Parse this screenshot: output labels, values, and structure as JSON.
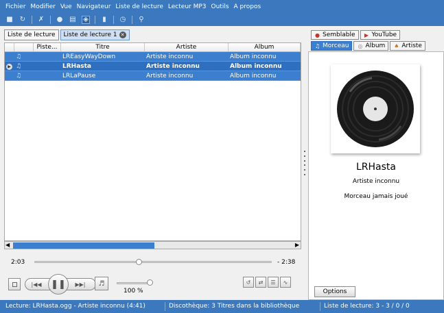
{
  "menu": [
    "Fichier",
    "Modifier",
    "Vue",
    "Navigateur",
    "Liste de lecture",
    "Lecteur MP3",
    "Outils",
    "A propos"
  ],
  "toolbar_icons": [
    "folder-icon",
    "refresh-icon",
    "tools-icon",
    "cd-icon",
    "window-icon",
    "podcast-icon",
    "book-icon",
    "clock-icon",
    "search-icon"
  ],
  "playlist_tabs": [
    {
      "label": "Liste de lecture"
    },
    {
      "label": "Liste de lecture 1"
    }
  ],
  "table": {
    "columns": [
      "Piste...",
      "Titre",
      "Artiste",
      "Album"
    ],
    "rows": [
      {
        "title": "LREasyWayDown",
        "artist": "Artiste inconnu",
        "album": "Album inconnu",
        "current": false
      },
      {
        "title": "LRHasta",
        "artist": "Artiste inconnu",
        "album": "Album inconnu",
        "current": true
      },
      {
        "title": "LRLaPause",
        "artist": "Artiste inconnu",
        "album": "Album inconnu",
        "current": false
      }
    ]
  },
  "player": {
    "elapsed": "2:03",
    "remaining": "- 2:38",
    "position_fraction": 0.44,
    "volume_label": "100 %",
    "volume_fraction": 1.0
  },
  "right_tabs_top": [
    "Semblable",
    "YouTube"
  ],
  "right_tabs_bottom": [
    "Morceau",
    "Album",
    "Artiste"
  ],
  "song": {
    "title": "LRHasta",
    "artist": "Artiste inconnu",
    "plays": "Morceau jamais joué"
  },
  "options_label": "Options",
  "status": {
    "current": "Lecture: LRHasta.ogg - Artiste inconnu (4:41)",
    "library": "Discothèque: 3 Titres dans la bibliothèque",
    "playlist": "Liste de lecture: 3 - 3 / 0 / 0"
  },
  "colors": {
    "accent": "#3b78bd",
    "selection": "#3c7fcf"
  }
}
